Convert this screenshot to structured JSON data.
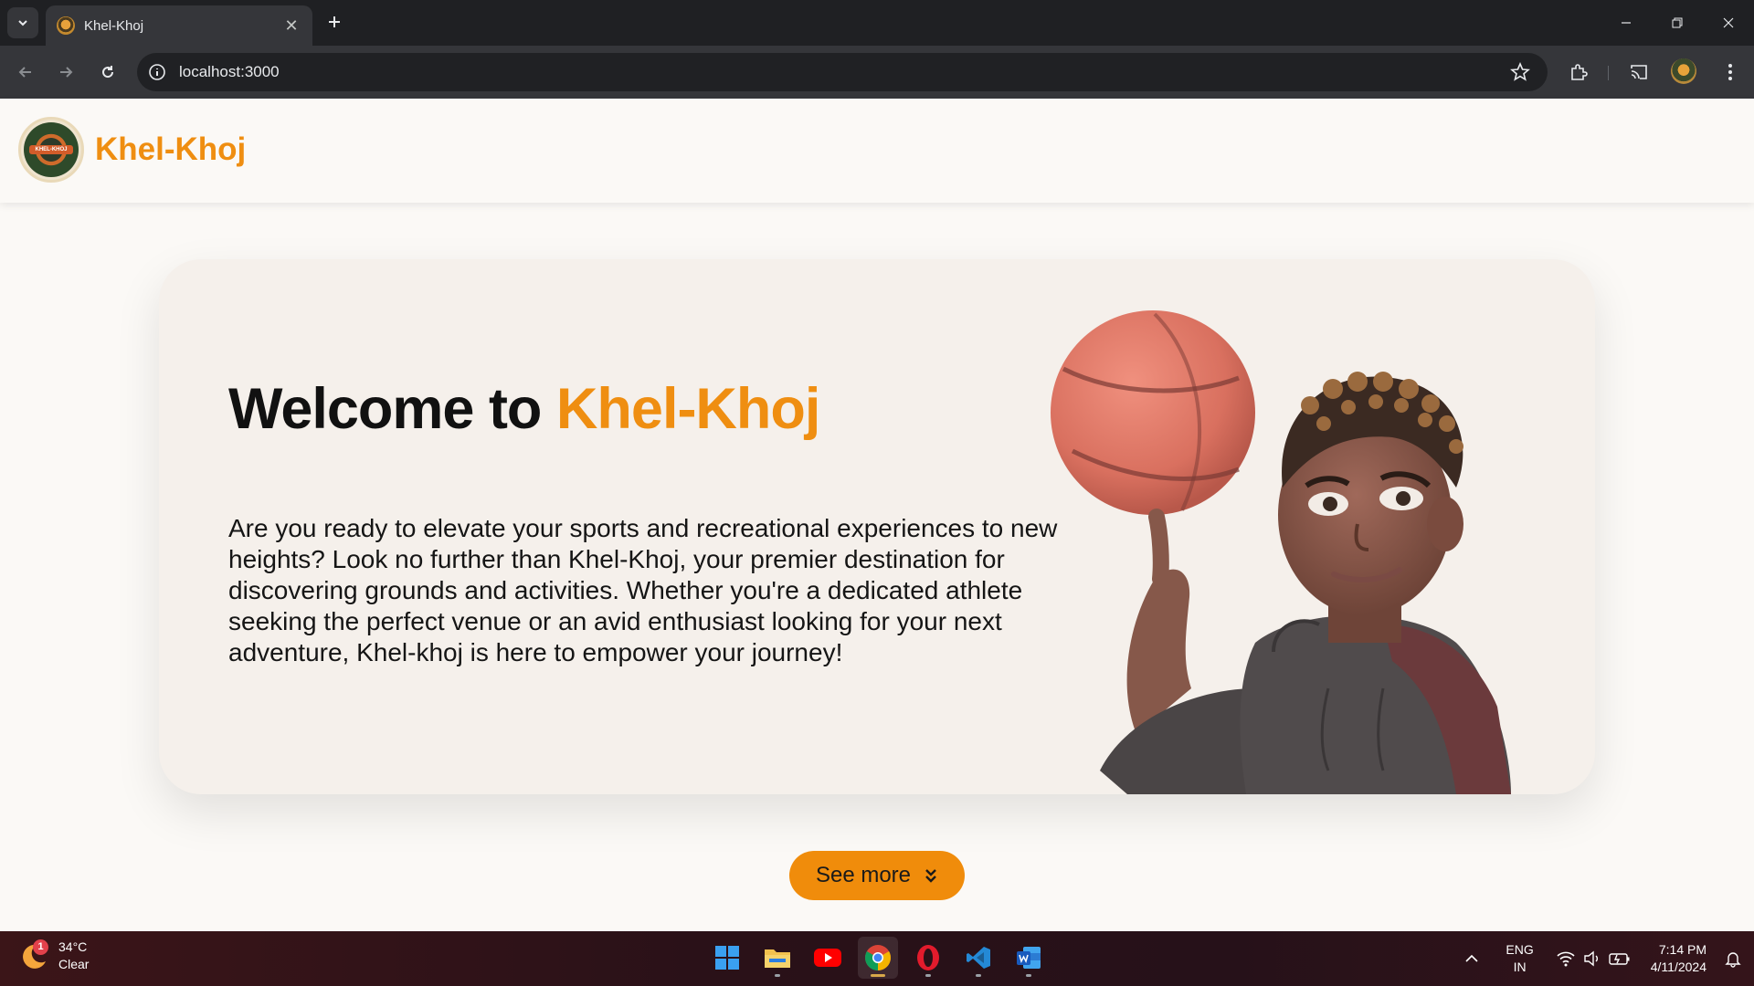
{
  "browser": {
    "tab_title": "Khel-Khoj",
    "url": "localhost:3000"
  },
  "site": {
    "brand": "Khel-Khoj",
    "logo_text": "KHEL-KHOJ",
    "accent_color": "#ef8e11",
    "hero": {
      "title_prefix": "Welcome to ",
      "title_accent": "Khel-Khoj",
      "description": "Are you ready to elevate your sports and recreational experiences to new heights? Look no further than Khel-Khoj, your premier destination for discovering grounds and activities. Whether you're a dedicated athlete seeking the perfect venue or an avid enthusiast looking for your next adventure, Khel-khoj is here to empower your journey!"
    },
    "see_more_label": "See more"
  },
  "taskbar": {
    "weather_temp": "34°C",
    "weather_desc": "Clear",
    "weather_badge": "1",
    "lang_top": "ENG",
    "lang_bottom": "IN",
    "time": "7:14 PM",
    "date": "4/11/2024",
    "apps": [
      "start-icon",
      "file-explorer-icon",
      "youtube-icon",
      "chrome-icon",
      "opera-icon",
      "vscode-icon",
      "word-icon"
    ]
  }
}
